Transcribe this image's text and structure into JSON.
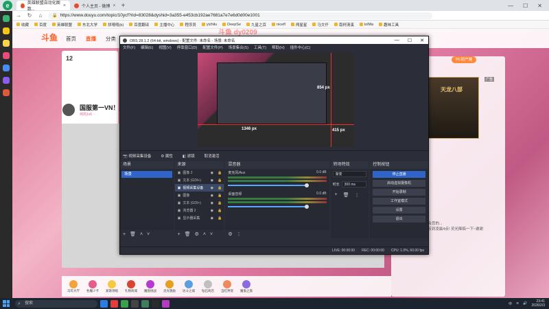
{
  "browser": {
    "tabs": [
      {
        "label": "英雄联盟自动化图数...",
        "active": true
      },
      {
        "label": "个人主页 - 微博",
        "active": false
      }
    ],
    "url": "https://www.douyu.com/topic/10ycf?rid=83028&dyshid=3a355-e453cb192ae7681a7e7e6d0d00e1001",
    "bookmarks": [
      "收藏",
      "百度",
      "英雄联盟",
      "东北大学",
      "拼嘻嘻(b)",
      "百度翻译",
      "主播中心",
      "程序员",
      "yizhilu",
      "DeepSe",
      "九星之百",
      "nicefl",
      "闯星星",
      "马文仟",
      "南柯清溪",
      "lolMa",
      "趣味工具"
    ]
  },
  "douyu": {
    "logo": "斗鱼",
    "nav": [
      "首页",
      "直播",
      "分类"
    ],
    "viewer_count": "12",
    "room_title": "国服第一VN！双",
    "level_tag": "帅风1v6",
    "pc_button": "PC别户端",
    "ad_tag": "广告",
    "ad_text": "天龙八部",
    "chat": [
      "主播已经为你推荐适合您的...",
      "公告: 直播时间,晚23点到凌晨4点! 灵光降临一下~谢谢",
      "购!",
      "帅风1v6 来了"
    ],
    "gifts": [
      "马年大厅",
      "各魔少卡",
      "爱歌领唱",
      "礼物商城",
      "魔盘挑战",
      "灵光激励",
      "达斗之城",
      "钻石商店",
      "当红神宠",
      "魔鬼之旅"
    ]
  },
  "obs": {
    "title": "OBS 28.1.2 (64-bit, windows) - 配置文件: 未命名 - 场景: 未命名",
    "menu": [
      "文件(F)",
      "编辑(E)",
      "视图(V)",
      "停靠窗口(D)",
      "配置文件(P)",
      "场景集合(S)",
      "工具(T)",
      "帮助(H)",
      "插件中心(C)"
    ],
    "preview_labels": {
      "width": "1346 px",
      "height1": "854 px",
      "height2": "415 px"
    },
    "source_bar": [
      "视频采集设备",
      "属性",
      "滤镜",
      "取消激活"
    ],
    "docks": {
      "scenes": {
        "title": "场景",
        "items": [
          "场景"
        ]
      },
      "sources": {
        "title": "来源",
        "items": [
          "图像 2",
          "文本 (GDI+)",
          "视频采集设备",
          "图像",
          "文本 (GDI+)",
          "浏览器 2",
          "显示器采集"
        ]
      },
      "mixer": {
        "title": "混音器",
        "channels": [
          {
            "name": "麦克风/Aux",
            "db": "0.0 dB"
          },
          {
            "name": "桌面音频",
            "db": "0.0 dB"
          }
        ]
      },
      "transitions": {
        "title": "转场特效",
        "type": "渐变",
        "duration_label": "时长",
        "duration": "300 ms"
      },
      "controls": {
        "title": "控制按钮",
        "buttons": [
          "停止直播",
          "启动虚拟摄像机",
          "开始录制",
          "工作室模式",
          "设置",
          "退出"
        ]
      }
    },
    "status": {
      "live": "LIVE: 00:00:00",
      "rec": "REC: 00:00:00",
      "cpu": "CPU: 1.0%, 60.00 fps"
    }
  },
  "taskbar": {
    "search": "搜索",
    "time": "23:41",
    "date": "2026/2/3"
  },
  "watermark": "斗鱼 dy0209"
}
